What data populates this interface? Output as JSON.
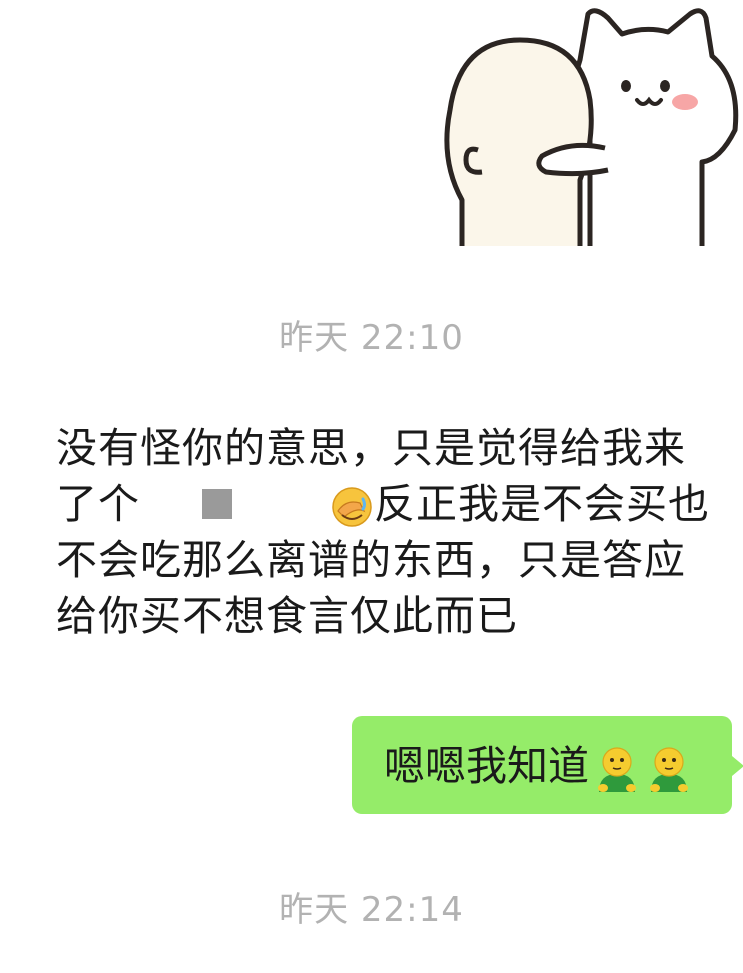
{
  "sticker": {
    "icon": "cat-hugging-figure-sticker"
  },
  "timestamps": {
    "first": "昨天 22:10",
    "second": "昨天 22:14"
  },
  "incoming_message": {
    "part1": "没有怪你的意思，只是觉得给我来了个",
    "redacted_icon": "censored-block",
    "emoji_icon": "face-palm-crying-emoji",
    "part2": "反正我是不会买也不会吃那么离谱的东西，只是答应给你买不想食言仅此而已"
  },
  "outgoing_message": {
    "text": "嗯嗯我知道",
    "emoji_icon": "yellow-face-green-shirt-emoji",
    "emoji_count": 2
  },
  "colors": {
    "bubble_green": "#95ec69",
    "timestamp_gray": "#b2b2b2"
  }
}
